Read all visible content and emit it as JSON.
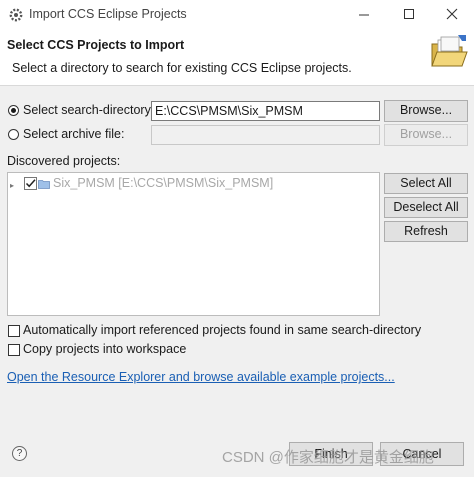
{
  "window": {
    "title": "Import CCS Eclipse Projects"
  },
  "header": {
    "title": "Select CCS Projects to Import",
    "description": "Select a directory to search for existing CCS Eclipse projects."
  },
  "search_directory": {
    "label": "Select search-directory:",
    "value": "E:\\CCS\\PMSM\\Six_PMSM",
    "selected": true,
    "browse_label": "Browse..."
  },
  "archive_file": {
    "label": "Select archive file:",
    "value": "",
    "selected": false,
    "browse_label": "Browse..."
  },
  "discovered": {
    "label": "Discovered projects:",
    "projects": [
      {
        "text": "Six_PMSM  [E:\\CCS\\PMSM\\Six_PMSM]",
        "checked": true
      }
    ],
    "select_all_label": "Select All",
    "deselect_all_label": "Deselect All",
    "refresh_label": "Refresh"
  },
  "options": {
    "auto_import_label": "Automatically import referenced projects found in same search-directory",
    "auto_import_checked": false,
    "copy_label": "Copy projects into workspace",
    "copy_checked": false
  },
  "link": {
    "text": "Open the Resource Explorer and browse available example projects..."
  },
  "footer": {
    "help_label": "?",
    "finish_label": "Finish",
    "cancel_label": "Cancel",
    "watermark": "CSDN @作家细胞才是黄金细胞"
  },
  "colors": {
    "link": "#1a5fb4",
    "disabled_text": "#a8a8a8",
    "background": "#f0f0f0"
  }
}
